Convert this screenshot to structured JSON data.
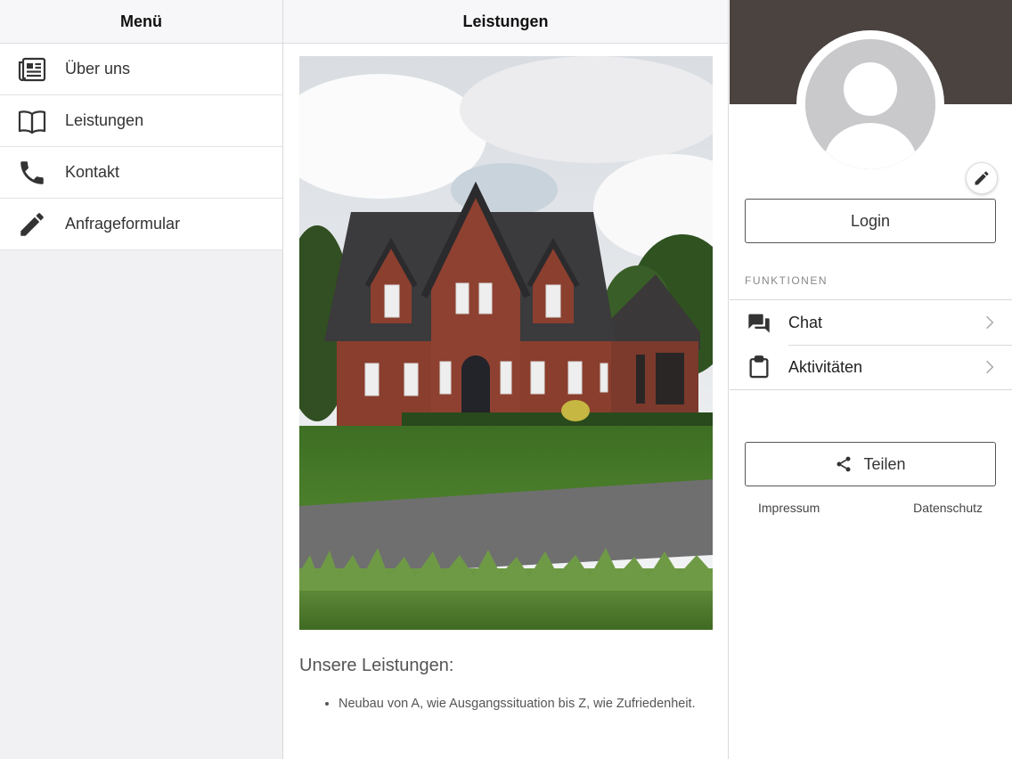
{
  "menu": {
    "title": "Menü",
    "items": [
      {
        "label": "Über uns",
        "icon": "newspaper-icon"
      },
      {
        "label": "Leistungen",
        "icon": "open-book-icon"
      },
      {
        "label": "Kontakt",
        "icon": "phone-icon"
      },
      {
        "label": "Anfrageformular",
        "icon": "pencil-icon"
      }
    ]
  },
  "content": {
    "title": "Leistungen",
    "section_title": "Unsere Leistungen:",
    "bullets": [
      "Neubau von A, wie Ausgangssituation bis Z, wie Zufriedenheit."
    ]
  },
  "sidebar": {
    "login_label": "Login",
    "functions_label": "FUNKTIONEN",
    "functions": [
      {
        "label": "Chat",
        "icon": "chat-icon"
      },
      {
        "label": "Aktivitäten",
        "icon": "clipboard-icon"
      }
    ],
    "share_label": "Teilen",
    "footer": {
      "impressum": "Impressum",
      "datenschutz": "Datenschutz"
    }
  },
  "colors": {
    "cover": "#4a4340",
    "menu_background": "#f1f1f3",
    "icon": "#333333"
  }
}
